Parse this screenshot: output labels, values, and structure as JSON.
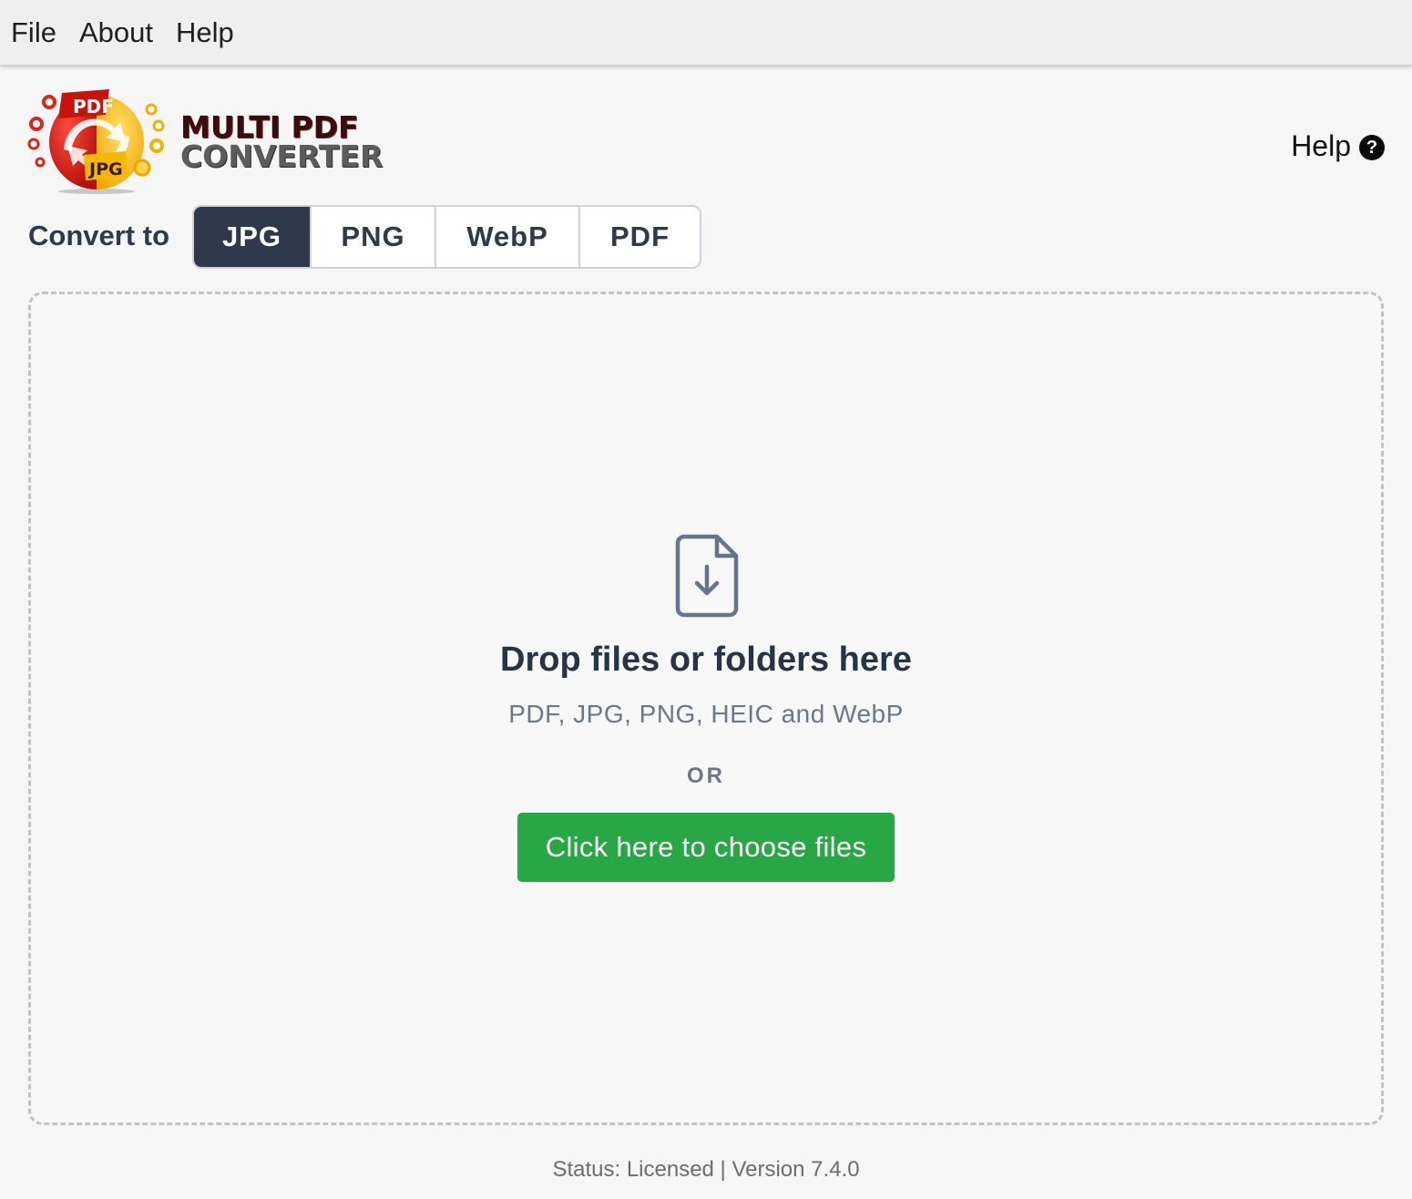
{
  "menubar": {
    "items": [
      "File",
      "About",
      "Help"
    ]
  },
  "header": {
    "logo_line1": "MULTI PDF",
    "logo_line2": "CONVERTER",
    "logo_badge_pdf": "PDF",
    "logo_badge_jpg": "JPG",
    "help_label": "Help",
    "help_icon_glyph": "?"
  },
  "convert": {
    "label": "Convert to",
    "formats": [
      "JPG",
      "PNG",
      "WebP",
      "PDF"
    ],
    "selected": "JPG"
  },
  "dropzone": {
    "icon": "file-download-icon",
    "title": "Drop files or folders here",
    "subtitle": "PDF, JPG, PNG, HEIC and WebP",
    "or_label": "OR",
    "choose_button": "Click here to choose files"
  },
  "footer": {
    "status": "Status: Licensed | Version 7.4.0"
  },
  "colors": {
    "selected_format_bg": "#2e3a4b",
    "choose_button_bg": "#28a745",
    "heading_text": "#263445",
    "muted_text": "#6a7889"
  }
}
